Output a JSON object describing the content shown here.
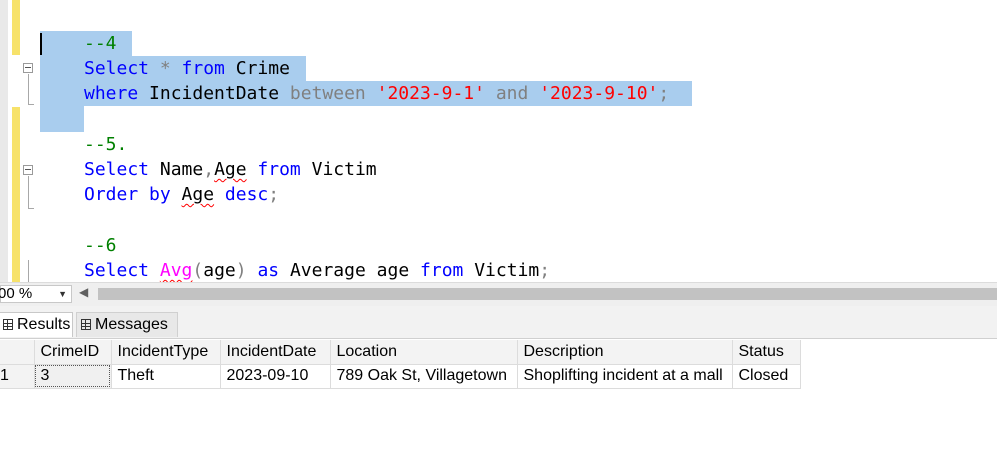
{
  "editor": {
    "lines": [
      {
        "id": "l1",
        "tokens": [
          {
            "t": "--4",
            "c": "comment"
          }
        ]
      },
      {
        "id": "l2",
        "tokens": [
          {
            "t": "Select",
            "c": "kw"
          },
          {
            "t": " * ",
            "c": "op"
          },
          {
            "t": "from",
            "c": "kw"
          },
          {
            "t": " Crime",
            "c": "plain"
          }
        ]
      },
      {
        "id": "l3",
        "tokens": [
          {
            "t": "where",
            "c": "kw"
          },
          {
            "t": " IncidentDate ",
            "c": "plain"
          },
          {
            "t": "between",
            "c": "op"
          },
          {
            "t": " ",
            "c": "plain"
          },
          {
            "t": "'2023-9-1'",
            "c": "str"
          },
          {
            "t": " ",
            "c": "plain"
          },
          {
            "t": "and",
            "c": "op"
          },
          {
            "t": " ",
            "c": "plain"
          },
          {
            "t": "'2023-9-10'",
            "c": "str"
          },
          {
            "t": ";",
            "c": "op"
          }
        ]
      },
      {
        "id": "l4",
        "tokens": [
          {
            "t": "--5.",
            "c": "comment"
          }
        ]
      },
      {
        "id": "l5",
        "tokens": [
          {
            "t": "Select",
            "c": "kw"
          },
          {
            "t": " Name",
            "c": "plain"
          },
          {
            "t": ",",
            "c": "op"
          },
          {
            "t": "Age",
            "c": "squig"
          },
          {
            "t": " ",
            "c": "plain"
          },
          {
            "t": "from",
            "c": "kw"
          },
          {
            "t": " Victim",
            "c": "plain"
          }
        ]
      },
      {
        "id": "l6",
        "tokens": [
          {
            "t": "Order by",
            "c": "kw"
          },
          {
            "t": " ",
            "c": "plain"
          },
          {
            "t": "Age",
            "c": "squig"
          },
          {
            "t": " ",
            "c": "plain"
          },
          {
            "t": "desc",
            "c": "kw"
          },
          {
            "t": ";",
            "c": "op"
          }
        ]
      },
      {
        "id": "l7",
        "tokens": [
          {
            "t": "--6",
            "c": "comment"
          }
        ]
      },
      {
        "id": "l8",
        "tokens": [
          {
            "t": "Select",
            "c": "kw"
          },
          {
            "t": " ",
            "c": "plain"
          },
          {
            "t": "Avg",
            "c": "fn-squig"
          },
          {
            "t": "(",
            "c": "op"
          },
          {
            "t": "age",
            "c": "plain"
          },
          {
            "t": ")",
            "c": "op"
          },
          {
            "t": " ",
            "c": "plain"
          },
          {
            "t": "as",
            "c": "kw"
          },
          {
            "t": " Average age ",
            "c": "plain"
          },
          {
            "t": "from",
            "c": "kw"
          },
          {
            "t": " Victim",
            "c": "plain"
          },
          {
            "t": ";",
            "c": "op"
          }
        ]
      }
    ]
  },
  "zoom": {
    "value": "00 %"
  },
  "tabs": {
    "results": "Results",
    "messages": "Messages"
  },
  "results": {
    "columns": [
      "CrimeID",
      "IncidentType",
      "IncidentDate",
      "Location",
      "Description",
      "Status"
    ],
    "rows": [
      {
        "rownum": "1",
        "cells": [
          "3",
          "Theft",
          "2023-09-10",
          "789 Oak St, Villagetown",
          "Shoplifting incident at a mall",
          "Closed"
        ]
      }
    ]
  },
  "colors": {
    "selection": "#a9cdee",
    "keyword": "#0000ff",
    "comment": "#008000",
    "string": "#ff0000",
    "function": "#ff00ff"
  }
}
